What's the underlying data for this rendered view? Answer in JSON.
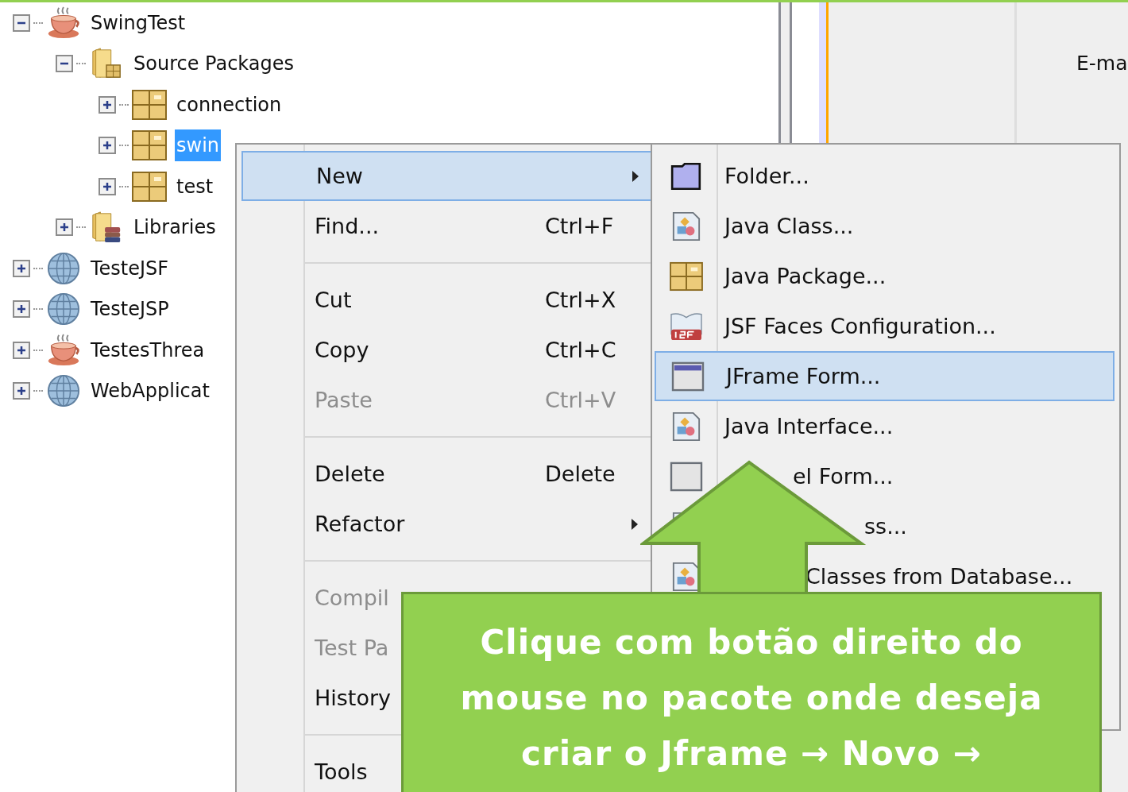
{
  "tree": [
    {
      "label": "SwingTest",
      "kind": "java-project",
      "expanded": true,
      "selected": false,
      "children": [
        {
          "label": "Source Packages",
          "kind": "source-folder",
          "expanded": true,
          "selected": false,
          "children": [
            {
              "label": "connection",
              "kind": "package",
              "expanded": false,
              "selected": false
            },
            {
              "label": "swin",
              "kind": "package",
              "expanded": false,
              "selected": true
            },
            {
              "label": "test",
              "kind": "package",
              "expanded": false,
              "selected": false
            }
          ]
        },
        {
          "label": "Libraries",
          "kind": "libraries",
          "expanded": false,
          "selected": false
        }
      ]
    },
    {
      "label": "TesteJSF",
      "kind": "web-project",
      "expanded": false,
      "selected": false
    },
    {
      "label": "TesteJSP",
      "kind": "web-project",
      "expanded": false,
      "selected": false
    },
    {
      "label": "TestesThrea",
      "kind": "java-project",
      "expanded": false,
      "selected": false
    },
    {
      "label": "WebApplicat",
      "kind": "web-project",
      "expanded": false,
      "selected": false
    }
  ],
  "editor": {
    "header": "E-ma"
  },
  "context_menu": {
    "items": [
      {
        "kind": "item",
        "label": "New",
        "selected": true,
        "disabled": false,
        "submenu": true
      },
      {
        "kind": "item",
        "label": "Find...",
        "shortcut": "Ctrl+F",
        "selected": false,
        "disabled": false,
        "submenu": false
      },
      {
        "kind": "separator"
      },
      {
        "kind": "item",
        "label": "Cut",
        "shortcut": "Ctrl+X",
        "selected": false,
        "disabled": false,
        "submenu": false
      },
      {
        "kind": "item",
        "label": "Copy",
        "shortcut": "Ctrl+C",
        "selected": false,
        "disabled": false,
        "submenu": false
      },
      {
        "kind": "item",
        "label": "Paste",
        "shortcut": "Ctrl+V",
        "selected": false,
        "disabled": true,
        "submenu": false
      },
      {
        "kind": "separator"
      },
      {
        "kind": "item",
        "label": "Delete",
        "shortcut": "Delete",
        "selected": false,
        "disabled": false,
        "submenu": false
      },
      {
        "kind": "item",
        "label": "Refactor",
        "selected": false,
        "disabled": false,
        "submenu": true
      },
      {
        "kind": "separator"
      },
      {
        "kind": "item",
        "label": "Compil",
        "selected": false,
        "disabled": true,
        "submenu": false
      },
      {
        "kind": "item",
        "label": "Test Pa",
        "selected": false,
        "disabled": true,
        "submenu": false
      },
      {
        "kind": "item",
        "label": "History",
        "selected": false,
        "disabled": false,
        "submenu": false
      },
      {
        "kind": "separator"
      },
      {
        "kind": "item",
        "label": "Tools",
        "selected": false,
        "disabled": false,
        "submenu": false
      }
    ]
  },
  "submenu": {
    "items": [
      {
        "label": "Folder...",
        "kind": "folder",
        "selected": false
      },
      {
        "label": "Java Class...",
        "kind": "class",
        "selected": false
      },
      {
        "label": "Java Package...",
        "kind": "package",
        "selected": false
      },
      {
        "label": "JSF Faces Configuration...",
        "kind": "jsf",
        "selected": false
      },
      {
        "label": "JFrame Form...",
        "kind": "frame",
        "selected": true
      },
      {
        "label": "Java Interface...",
        "kind": "class",
        "selected": false
      },
      {
        "label": "el Form...",
        "kind": "panel",
        "selected": false
      },
      {
        "label": "ss...",
        "kind": "class",
        "selected": false
      },
      {
        "label": "Classes from Database...",
        "kind": "class",
        "selected": false
      }
    ]
  },
  "callout": {
    "text": "Clique com botão direito do\nmouse no pacote onde deseja\ncriar o Jframe → Novo →"
  }
}
